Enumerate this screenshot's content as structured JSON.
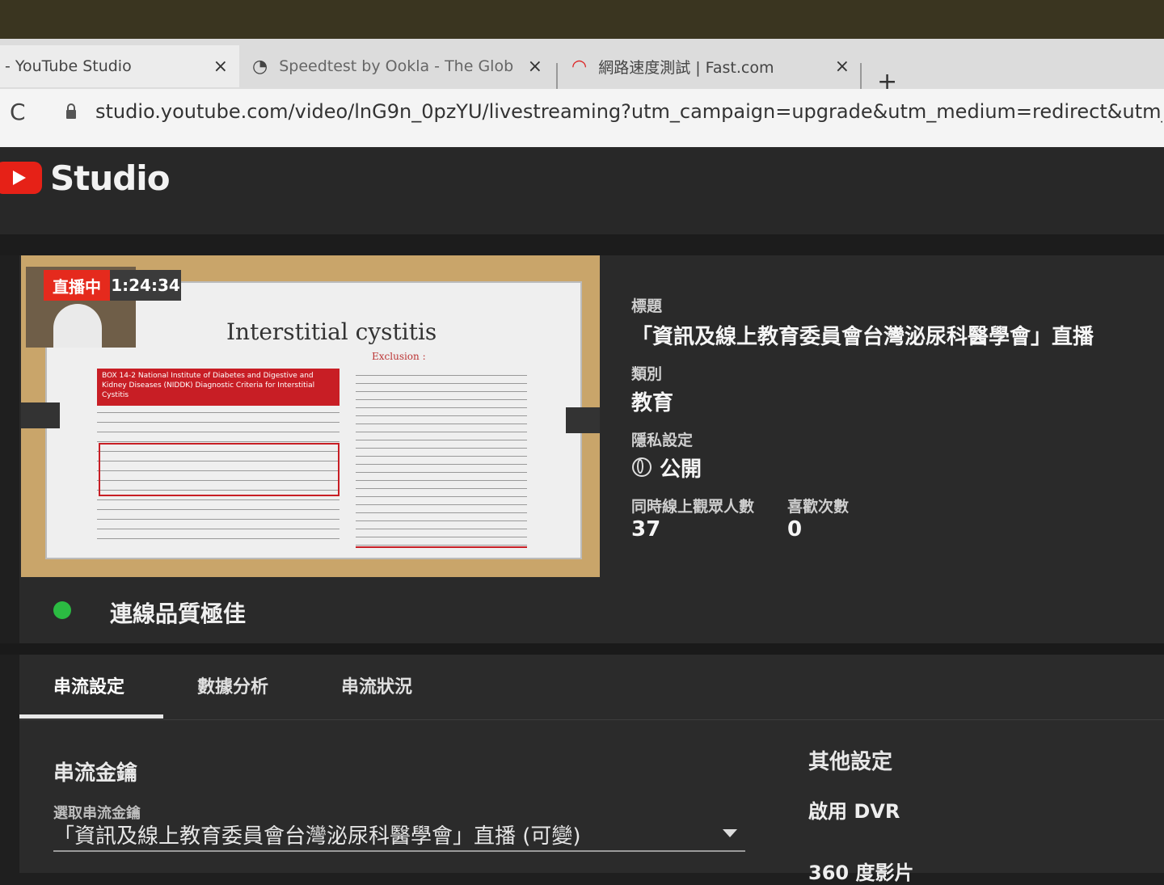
{
  "browser": {
    "tabs": [
      {
        "title": "- YouTube Studio",
        "close": "×"
      },
      {
        "title": "Speedtest by Ookla - The Glob",
        "close": "×"
      },
      {
        "title": "網路速度測試 | Fast.com",
        "close": "×"
      }
    ],
    "new_tab": "+",
    "reload": "C",
    "url": "studio.youtube.com/video/lnG9n_0pzYU/livestreaming?utm_campaign=upgrade&utm_medium=redirect&utm_source=%2Fliv"
  },
  "header": {
    "brand": "Studio"
  },
  "preview": {
    "live_label": "直播中",
    "elapsed": "1:24:34",
    "slide_title": "Interstitial cystitis",
    "slide_sub": "Exclusion :",
    "box_heading": "BOX 14-2 National Institute of Diabetes and Digestive and Kidney Diseases (NIDDK) Diagnostic Criteria for Interstitial Cystitis"
  },
  "info": {
    "title_label": "標題",
    "title_value": "「資訊及線上教育委員會台灣泌尿科醫學會」直播",
    "category_label": "類別",
    "category_value": "教育",
    "privacy_label": "隱私設定",
    "privacy_value": "公開",
    "viewers_label": "同時線上觀眾人數",
    "viewers_value": "37",
    "likes_label": "喜歡次數",
    "likes_value": "0"
  },
  "status": {
    "quality": "連線品質極佳",
    "color": "#2bbb42"
  },
  "tabs": [
    "串流設定",
    "數據分析",
    "串流狀況"
  ],
  "stream_key": {
    "section": "串流金鑰",
    "select_label": "選取串流金鑰",
    "select_value": "「資訊及線上教育委員會台灣泌尿科醫學會」直播 (可變)"
  },
  "other": {
    "section": "其他設定",
    "options": [
      "啟用 DVR",
      "360 度影片"
    ]
  }
}
